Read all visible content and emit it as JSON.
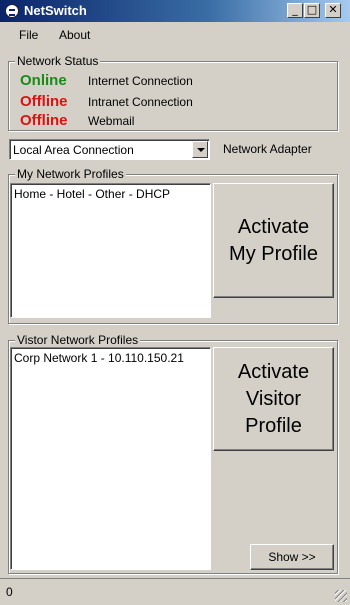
{
  "window": {
    "title": "NetSwitch",
    "minimize": "_",
    "maximize": "□",
    "close": "✕"
  },
  "menu": {
    "file": "File",
    "about": "About"
  },
  "network_status": {
    "legend": "Network Status",
    "rows": [
      {
        "status": "Online",
        "label": "Internet Connection",
        "color": "#1a8a1a"
      },
      {
        "status": "Offline",
        "label": "Intranet Connection",
        "color": "#e01010"
      },
      {
        "status": "Offline",
        "label": "Webmail",
        "color": "#e01010"
      }
    ]
  },
  "adapter": {
    "selected": "Local Area Connection",
    "label": "Network Adapter"
  },
  "my_profiles": {
    "legend": "My Network Profiles",
    "items": [
      "Home - Hotel - Other - DHCP"
    ],
    "button": "Activate\nMy Profile"
  },
  "visitor_profiles": {
    "legend": "Vistor Network Profiles",
    "items": [
      "Corp Network 1 - 10.110.150.21"
    ],
    "button": "Activate\nVisitor\nProfile",
    "show_button": "Show >>"
  },
  "statusbar": {
    "text": "0"
  }
}
